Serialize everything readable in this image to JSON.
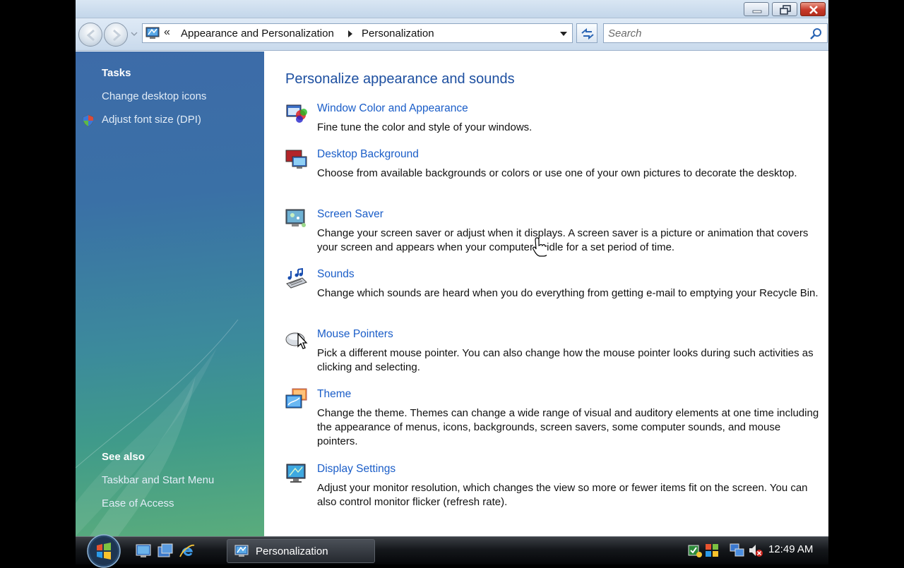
{
  "window": {
    "address": {
      "crumb_prefix": "«",
      "crumb1": "Appearance and Personalization",
      "crumb2": "Personalization"
    },
    "search": {
      "placeholder": "Search"
    }
  },
  "left_pane": {
    "tasks_heading": "Tasks",
    "tasks": [
      {
        "label": "Change desktop icons"
      },
      {
        "label": "Adjust font size (DPI)",
        "icon": "uac-shield-icon"
      }
    ],
    "see_also_heading": "See also",
    "see_also": [
      {
        "label": "Taskbar and Start Menu"
      },
      {
        "label": "Ease of Access"
      }
    ]
  },
  "main": {
    "title": "Personalize appearance and sounds",
    "items": [
      {
        "link": "Window Color and Appearance",
        "desc": "Fine tune the color and style of your windows.",
        "icon": "window-color-icon"
      },
      {
        "link": "Desktop Background",
        "desc": "Choose from available backgrounds or colors or use one of your own pictures to decorate the desktop.",
        "icon": "desktop-background-icon"
      },
      {
        "link": "Screen Saver",
        "desc": "Change your screen saver or adjust when it displays. A screen saver is a picture or animation that covers your screen and appears when your computer is idle for a set period of time.",
        "icon": "screen-saver-icon"
      },
      {
        "link": "Sounds",
        "desc": "Change which sounds are heard when you do everything from getting e-mail to emptying your Recycle Bin.",
        "icon": "sounds-icon"
      },
      {
        "link": "Mouse Pointers",
        "desc": "Pick a different mouse pointer. You can also change how the mouse pointer looks during such activities as clicking and selecting.",
        "icon": "mouse-pointers-icon"
      },
      {
        "link": "Theme",
        "desc": "Change the theme. Themes can change a wide range of visual and auditory elements at one time including the appearance of menus, icons, backgrounds, screen savers, some computer sounds, and mouse pointers.",
        "icon": "theme-icon"
      },
      {
        "link": "Display Settings",
        "desc": "Adjust your monitor resolution, which changes the view so more or fewer items fit on the screen. You can also control monitor flicker (refresh rate).",
        "icon": "display-settings-icon"
      }
    ]
  },
  "taskbar": {
    "task_label": "Personalization",
    "clock": "12:49 AM"
  },
  "colors": {
    "link": "#1a5dc8",
    "title": "#1d4fa0",
    "taskbar": "#15181c"
  }
}
